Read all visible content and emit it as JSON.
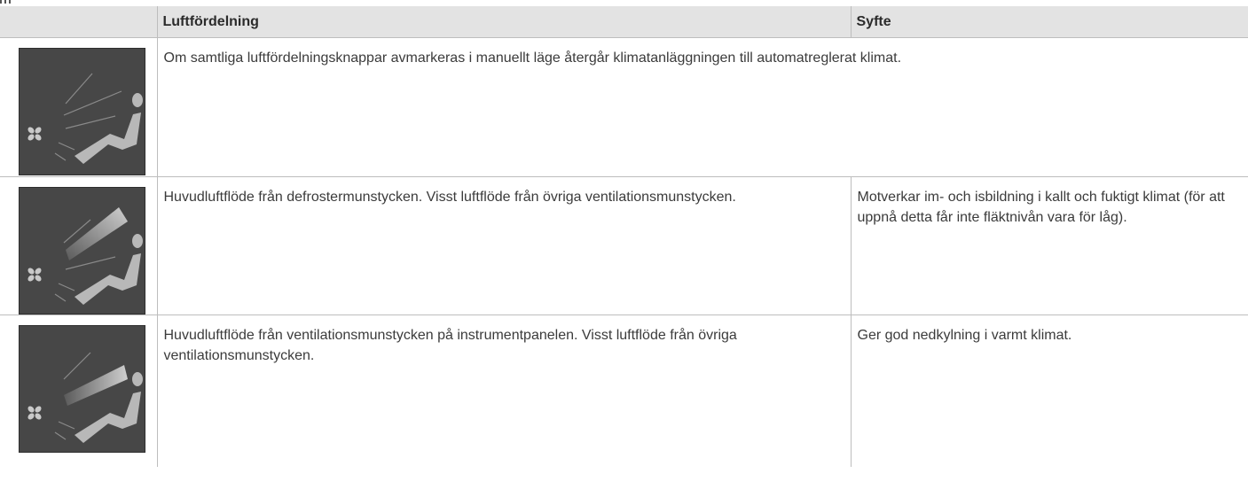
{
  "table": {
    "headers": {
      "icon": "",
      "distribution": "Luftfördelning",
      "purpose": "Syfte"
    },
    "rows": [
      {
        "icon": "seat-fan-airflow-icon-all-off",
        "distribution": "Om samtliga luftfördelningsknappar avmarkeras i manuellt läge återgår klimatanläggningen till automatreglerat klimat.",
        "purpose": ""
      },
      {
        "icon": "seat-fan-airflow-icon-defroster",
        "distribution": "Huvudluftflöde från defrostermunstycken. Visst luftflöde från övriga ventilations­munstycken.",
        "purpose": "Motverkar im- och isbildning i kallt och fuktigt klimat (för att uppnå detta får inte fläktnivån vara för låg)."
      },
      {
        "icon": "seat-fan-airflow-icon-dashboard-vents",
        "distribution": "Huvudluftflöde från ventilationsmunstycken på instrumentpanelen. Visst luft­flöde från övriga ventilationsmunstycken.",
        "purpose": "Ger god nedkylning i varmt klimat."
      }
    ]
  },
  "colors": {
    "header_bg": "#e3e3e3",
    "icon_bg": "#474747",
    "icon_line": "#9a9a9a",
    "icon_seat": "#b8b8b8",
    "text": "#3b3b3b"
  }
}
